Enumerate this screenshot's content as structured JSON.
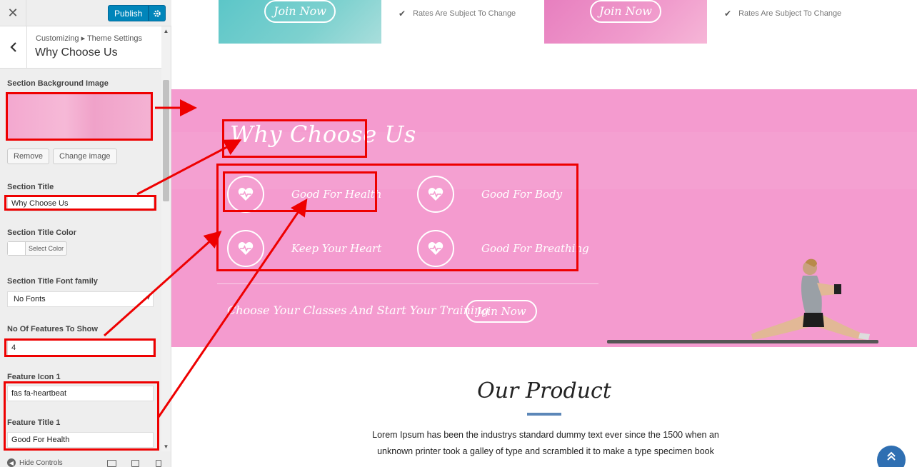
{
  "customizer": {
    "close_label": "✕",
    "publish_label": "Publish",
    "breadcrumb": "Customizing ▸ Theme Settings",
    "section_title": "Why Choose Us",
    "fields": {
      "bg_image_label": "Section Background Image",
      "remove_label": "Remove",
      "change_image_label": "Change image",
      "title_label": "Section Title",
      "title_value": "Why Choose Us",
      "title_color_label": "Section Title Color",
      "select_color_label": "Select Color",
      "font_family_label": "Section Title Font family",
      "font_family_value": "No Fonts",
      "features_count_label": "No Of Features To Show",
      "features_count_value": "4",
      "feature_icon_label": "Feature Icon 1",
      "feature_icon_value": "fas fa-heartbeat",
      "feature_title_label": "Feature Title 1",
      "feature_title_value": "Good For Health"
    },
    "hide_controls_label": "Hide Controls"
  },
  "preview": {
    "cards": {
      "join_label": "Join Now",
      "rates_text": "Rates Are Subject To Change"
    },
    "why": {
      "title": "Why Choose Us",
      "features": [
        {
          "title": "Good For Health",
          "icon": "heartbeat-icon"
        },
        {
          "title": "Good For Body",
          "icon": "heartbeat-icon"
        },
        {
          "title": "Keep Your Heart",
          "icon": "heartbeat-icon"
        },
        {
          "title": "Good For Breathing",
          "icon": "heartbeat-icon"
        }
      ],
      "cta_text": "Choose Your Classes And Start Your Training",
      "cta_button": "Join Now"
    },
    "product": {
      "title": "Our Product",
      "description": "Lorem Ipsum has been the industrys standard dummy text ever since the 1500 when an unknown printer took a galley of type and scrambled it to make a type specimen book"
    }
  },
  "colors": {
    "publish_blue": "#0085ba",
    "band_pink": "#f49bcf",
    "annotation_red": "#e00000",
    "scroll_top_blue": "#2f6fb2"
  }
}
